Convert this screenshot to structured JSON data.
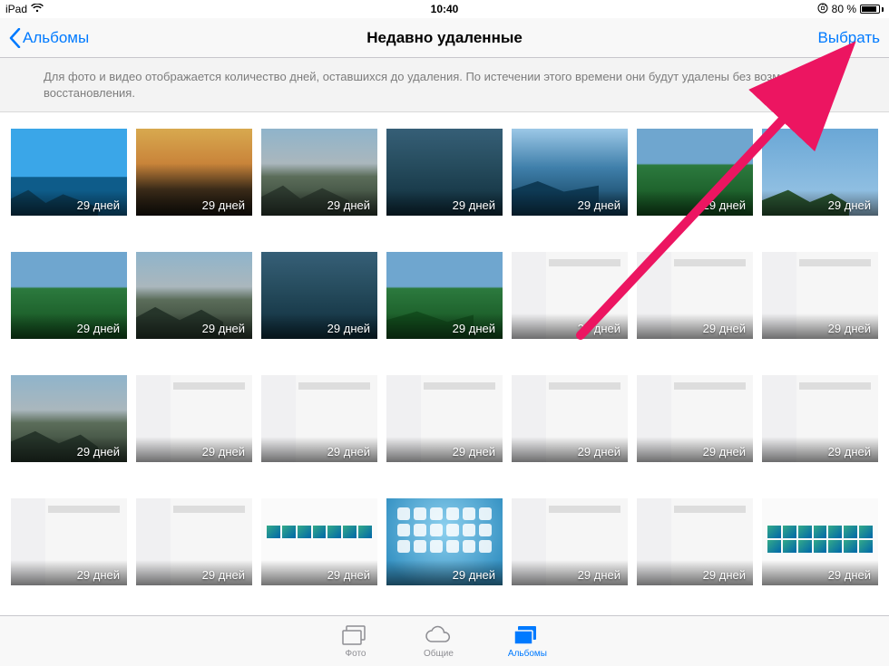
{
  "status": {
    "device": "iPad",
    "time": "10:40",
    "battery_percent": "80 %"
  },
  "nav": {
    "back_label": "Альбомы",
    "title": "Недавно удаленные",
    "select_label": "Выбрать"
  },
  "info_banner": "Для фото и видео отображается количество дней, оставшихся до удаления. По истечении этого времени они будут удалены без возможности восстановления.",
  "days_label": "29 дней",
  "tabs": {
    "photos": "Фото",
    "shared": "Общие",
    "albums": "Альбомы"
  }
}
